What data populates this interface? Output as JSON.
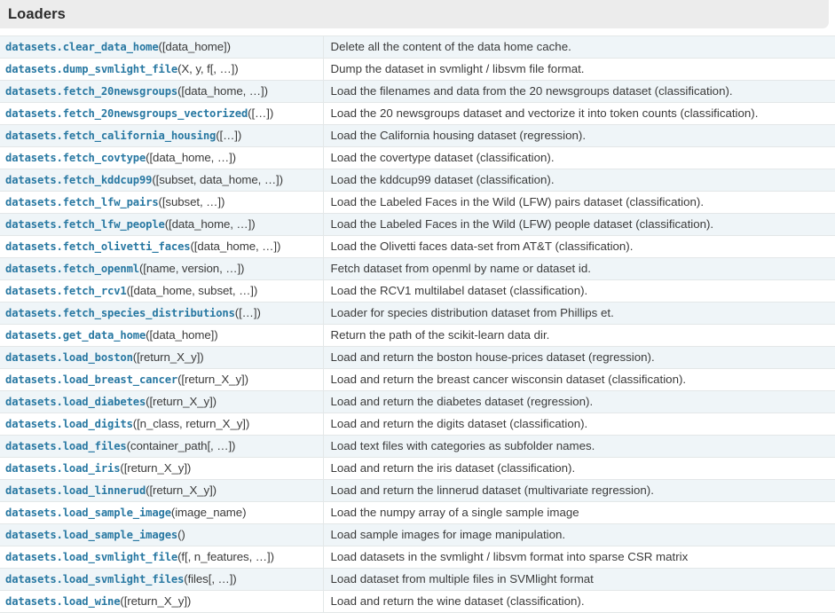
{
  "section": {
    "title": "Loaders"
  },
  "table": {
    "rows": [
      {
        "fn": "datasets.clear_data_home",
        "args": "([data_home])",
        "desc": "Delete all the content of the data home cache."
      },
      {
        "fn": "datasets.dump_svmlight_file",
        "args": "(X, y, f[, …])",
        "desc": "Dump the dataset in svmlight / libsvm file format."
      },
      {
        "fn": "datasets.fetch_20newsgroups",
        "args": "([data_home, …])",
        "desc": "Load the filenames and data from the 20 newsgroups dataset (classification)."
      },
      {
        "fn": "datasets.fetch_20newsgroups_vectorized",
        "args": "([…])",
        "desc": "Load the 20 newsgroups dataset and vectorize it into token counts (classification)."
      },
      {
        "fn": "datasets.fetch_california_housing",
        "args": "([…])",
        "desc": "Load the California housing dataset (regression)."
      },
      {
        "fn": "datasets.fetch_covtype",
        "args": "([data_home, …])",
        "desc": "Load the covertype dataset (classification)."
      },
      {
        "fn": "datasets.fetch_kddcup99",
        "args": "([subset, data_home, …])",
        "desc": "Load the kddcup99 dataset (classification)."
      },
      {
        "fn": "datasets.fetch_lfw_pairs",
        "args": "([subset, …])",
        "desc": "Load the Labeled Faces in the Wild (LFW) pairs dataset (classification)."
      },
      {
        "fn": "datasets.fetch_lfw_people",
        "args": "([data_home, …])",
        "desc": "Load the Labeled Faces in the Wild (LFW) people dataset (classification)."
      },
      {
        "fn": "datasets.fetch_olivetti_faces",
        "args": "([data_home, …])",
        "desc": "Load the Olivetti faces data-set from AT&T (classification)."
      },
      {
        "fn": "datasets.fetch_openml",
        "args": "([name, version, …])",
        "desc": "Fetch dataset from openml by name or dataset id."
      },
      {
        "fn": "datasets.fetch_rcv1",
        "args": "([data_home, subset, …])",
        "desc": "Load the RCV1 multilabel dataset (classification)."
      },
      {
        "fn": "datasets.fetch_species_distributions",
        "args": "([…])",
        "desc": "Loader for species distribution dataset from Phillips et."
      },
      {
        "fn": "datasets.get_data_home",
        "args": "([data_home])",
        "desc": "Return the path of the scikit-learn data dir."
      },
      {
        "fn": "datasets.load_boston",
        "args": "([return_X_y])",
        "desc": "Load and return the boston house-prices dataset (regression)."
      },
      {
        "fn": "datasets.load_breast_cancer",
        "args": "([return_X_y])",
        "desc": "Load and return the breast cancer wisconsin dataset (classification)."
      },
      {
        "fn": "datasets.load_diabetes",
        "args": "([return_X_y])",
        "desc": "Load and return the diabetes dataset (regression)."
      },
      {
        "fn": "datasets.load_digits",
        "args": "([n_class, return_X_y])",
        "desc": "Load and return the digits dataset (classification)."
      },
      {
        "fn": "datasets.load_files",
        "args": "(container_path[, …])",
        "desc": "Load text files with categories as subfolder names."
      },
      {
        "fn": "datasets.load_iris",
        "args": "([return_X_y])",
        "desc": "Load and return the iris dataset (classification)."
      },
      {
        "fn": "datasets.load_linnerud",
        "args": "([return_X_y])",
        "desc": "Load and return the linnerud dataset (multivariate regression)."
      },
      {
        "fn": "datasets.load_sample_image",
        "args": "(image_name)",
        "desc": "Load the numpy array of a single sample image"
      },
      {
        "fn": "datasets.load_sample_images",
        "args": "()",
        "desc": "Load sample images for image manipulation."
      },
      {
        "fn": "datasets.load_svmlight_file",
        "args": "(f[, n_features, …])",
        "desc": "Load datasets in the svmlight / libsvm format into sparse CSR matrix"
      },
      {
        "fn": "datasets.load_svmlight_files",
        "args": "(files[, …])",
        "desc": "Load dataset from multiple files in SVMlight format"
      },
      {
        "fn": "datasets.load_wine",
        "args": "([return_X_y])",
        "desc": "Load and return the wine dataset (classification)."
      }
    ]
  },
  "colors": {
    "link": "#2878a2",
    "header_bg": "#ececec",
    "row_alt_bg": "#eff5f8",
    "border": "#e3e7e8",
    "text": "#3b3b3b"
  }
}
